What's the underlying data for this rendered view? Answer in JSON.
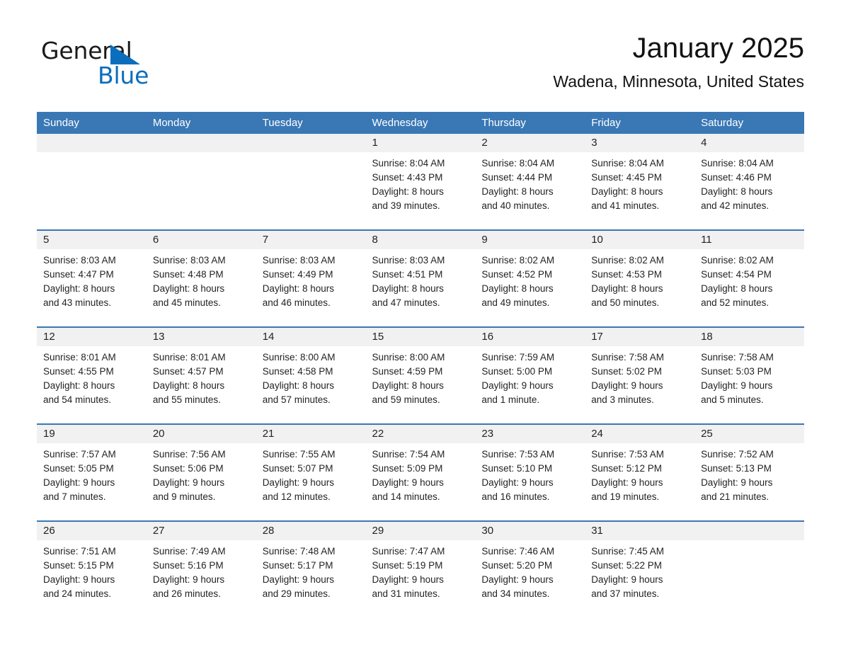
{
  "brand": {
    "name_part1": "General",
    "name_part2": "Blue",
    "accent_color": "#0a6ebd"
  },
  "header": {
    "month_title": "January 2025",
    "location": "Wadena, Minnesota, United States"
  },
  "theme": {
    "header_blue": "#3a78b5",
    "daynum_band": "#f1f1f1",
    "text": "#232323"
  },
  "weekday_headers": [
    "Sunday",
    "Monday",
    "Tuesday",
    "Wednesday",
    "Thursday",
    "Friday",
    "Saturday"
  ],
  "weeks": [
    [
      {
        "day": "",
        "sunrise": "",
        "sunset": "",
        "daylight_line1": "",
        "daylight_line2": ""
      },
      {
        "day": "",
        "sunrise": "",
        "sunset": "",
        "daylight_line1": "",
        "daylight_line2": ""
      },
      {
        "day": "",
        "sunrise": "",
        "sunset": "",
        "daylight_line1": "",
        "daylight_line2": ""
      },
      {
        "day": "1",
        "sunrise": "Sunrise: 8:04 AM",
        "sunset": "Sunset: 4:43 PM",
        "daylight_line1": "Daylight: 8 hours",
        "daylight_line2": "and 39 minutes."
      },
      {
        "day": "2",
        "sunrise": "Sunrise: 8:04 AM",
        "sunset": "Sunset: 4:44 PM",
        "daylight_line1": "Daylight: 8 hours",
        "daylight_line2": "and 40 minutes."
      },
      {
        "day": "3",
        "sunrise": "Sunrise: 8:04 AM",
        "sunset": "Sunset: 4:45 PM",
        "daylight_line1": "Daylight: 8 hours",
        "daylight_line2": "and 41 minutes."
      },
      {
        "day": "4",
        "sunrise": "Sunrise: 8:04 AM",
        "sunset": "Sunset: 4:46 PM",
        "daylight_line1": "Daylight: 8 hours",
        "daylight_line2": "and 42 minutes."
      }
    ],
    [
      {
        "day": "5",
        "sunrise": "Sunrise: 8:03 AM",
        "sunset": "Sunset: 4:47 PM",
        "daylight_line1": "Daylight: 8 hours",
        "daylight_line2": "and 43 minutes."
      },
      {
        "day": "6",
        "sunrise": "Sunrise: 8:03 AM",
        "sunset": "Sunset: 4:48 PM",
        "daylight_line1": "Daylight: 8 hours",
        "daylight_line2": "and 45 minutes."
      },
      {
        "day": "7",
        "sunrise": "Sunrise: 8:03 AM",
        "sunset": "Sunset: 4:49 PM",
        "daylight_line1": "Daylight: 8 hours",
        "daylight_line2": "and 46 minutes."
      },
      {
        "day": "8",
        "sunrise": "Sunrise: 8:03 AM",
        "sunset": "Sunset: 4:51 PM",
        "daylight_line1": "Daylight: 8 hours",
        "daylight_line2": "and 47 minutes."
      },
      {
        "day": "9",
        "sunrise": "Sunrise: 8:02 AM",
        "sunset": "Sunset: 4:52 PM",
        "daylight_line1": "Daylight: 8 hours",
        "daylight_line2": "and 49 minutes."
      },
      {
        "day": "10",
        "sunrise": "Sunrise: 8:02 AM",
        "sunset": "Sunset: 4:53 PM",
        "daylight_line1": "Daylight: 8 hours",
        "daylight_line2": "and 50 minutes."
      },
      {
        "day": "11",
        "sunrise": "Sunrise: 8:02 AM",
        "sunset": "Sunset: 4:54 PM",
        "daylight_line1": "Daylight: 8 hours",
        "daylight_line2": "and 52 minutes."
      }
    ],
    [
      {
        "day": "12",
        "sunrise": "Sunrise: 8:01 AM",
        "sunset": "Sunset: 4:55 PM",
        "daylight_line1": "Daylight: 8 hours",
        "daylight_line2": "and 54 minutes."
      },
      {
        "day": "13",
        "sunrise": "Sunrise: 8:01 AM",
        "sunset": "Sunset: 4:57 PM",
        "daylight_line1": "Daylight: 8 hours",
        "daylight_line2": "and 55 minutes."
      },
      {
        "day": "14",
        "sunrise": "Sunrise: 8:00 AM",
        "sunset": "Sunset: 4:58 PM",
        "daylight_line1": "Daylight: 8 hours",
        "daylight_line2": "and 57 minutes."
      },
      {
        "day": "15",
        "sunrise": "Sunrise: 8:00 AM",
        "sunset": "Sunset: 4:59 PM",
        "daylight_line1": "Daylight: 8 hours",
        "daylight_line2": "and 59 minutes."
      },
      {
        "day": "16",
        "sunrise": "Sunrise: 7:59 AM",
        "sunset": "Sunset: 5:00 PM",
        "daylight_line1": "Daylight: 9 hours",
        "daylight_line2": "and 1 minute."
      },
      {
        "day": "17",
        "sunrise": "Sunrise: 7:58 AM",
        "sunset": "Sunset: 5:02 PM",
        "daylight_line1": "Daylight: 9 hours",
        "daylight_line2": "and 3 minutes."
      },
      {
        "day": "18",
        "sunrise": "Sunrise: 7:58 AM",
        "sunset": "Sunset: 5:03 PM",
        "daylight_line1": "Daylight: 9 hours",
        "daylight_line2": "and 5 minutes."
      }
    ],
    [
      {
        "day": "19",
        "sunrise": "Sunrise: 7:57 AM",
        "sunset": "Sunset: 5:05 PM",
        "daylight_line1": "Daylight: 9 hours",
        "daylight_line2": "and 7 minutes."
      },
      {
        "day": "20",
        "sunrise": "Sunrise: 7:56 AM",
        "sunset": "Sunset: 5:06 PM",
        "daylight_line1": "Daylight: 9 hours",
        "daylight_line2": "and 9 minutes."
      },
      {
        "day": "21",
        "sunrise": "Sunrise: 7:55 AM",
        "sunset": "Sunset: 5:07 PM",
        "daylight_line1": "Daylight: 9 hours",
        "daylight_line2": "and 12 minutes."
      },
      {
        "day": "22",
        "sunrise": "Sunrise: 7:54 AM",
        "sunset": "Sunset: 5:09 PM",
        "daylight_line1": "Daylight: 9 hours",
        "daylight_line2": "and 14 minutes."
      },
      {
        "day": "23",
        "sunrise": "Sunrise: 7:53 AM",
        "sunset": "Sunset: 5:10 PM",
        "daylight_line1": "Daylight: 9 hours",
        "daylight_line2": "and 16 minutes."
      },
      {
        "day": "24",
        "sunrise": "Sunrise: 7:53 AM",
        "sunset": "Sunset: 5:12 PM",
        "daylight_line1": "Daylight: 9 hours",
        "daylight_line2": "and 19 minutes."
      },
      {
        "day": "25",
        "sunrise": "Sunrise: 7:52 AM",
        "sunset": "Sunset: 5:13 PM",
        "daylight_line1": "Daylight: 9 hours",
        "daylight_line2": "and 21 minutes."
      }
    ],
    [
      {
        "day": "26",
        "sunrise": "Sunrise: 7:51 AM",
        "sunset": "Sunset: 5:15 PM",
        "daylight_line1": "Daylight: 9 hours",
        "daylight_line2": "and 24 minutes."
      },
      {
        "day": "27",
        "sunrise": "Sunrise: 7:49 AM",
        "sunset": "Sunset: 5:16 PM",
        "daylight_line1": "Daylight: 9 hours",
        "daylight_line2": "and 26 minutes."
      },
      {
        "day": "28",
        "sunrise": "Sunrise: 7:48 AM",
        "sunset": "Sunset: 5:17 PM",
        "daylight_line1": "Daylight: 9 hours",
        "daylight_line2": "and 29 minutes."
      },
      {
        "day": "29",
        "sunrise": "Sunrise: 7:47 AM",
        "sunset": "Sunset: 5:19 PM",
        "daylight_line1": "Daylight: 9 hours",
        "daylight_line2": "and 31 minutes."
      },
      {
        "day": "30",
        "sunrise": "Sunrise: 7:46 AM",
        "sunset": "Sunset: 5:20 PM",
        "daylight_line1": "Daylight: 9 hours",
        "daylight_line2": "and 34 minutes."
      },
      {
        "day": "31",
        "sunrise": "Sunrise: 7:45 AM",
        "sunset": "Sunset: 5:22 PM",
        "daylight_line1": "Daylight: 9 hours",
        "daylight_line2": "and 37 minutes."
      },
      {
        "day": "",
        "sunrise": "",
        "sunset": "",
        "daylight_line1": "",
        "daylight_line2": ""
      }
    ]
  ]
}
